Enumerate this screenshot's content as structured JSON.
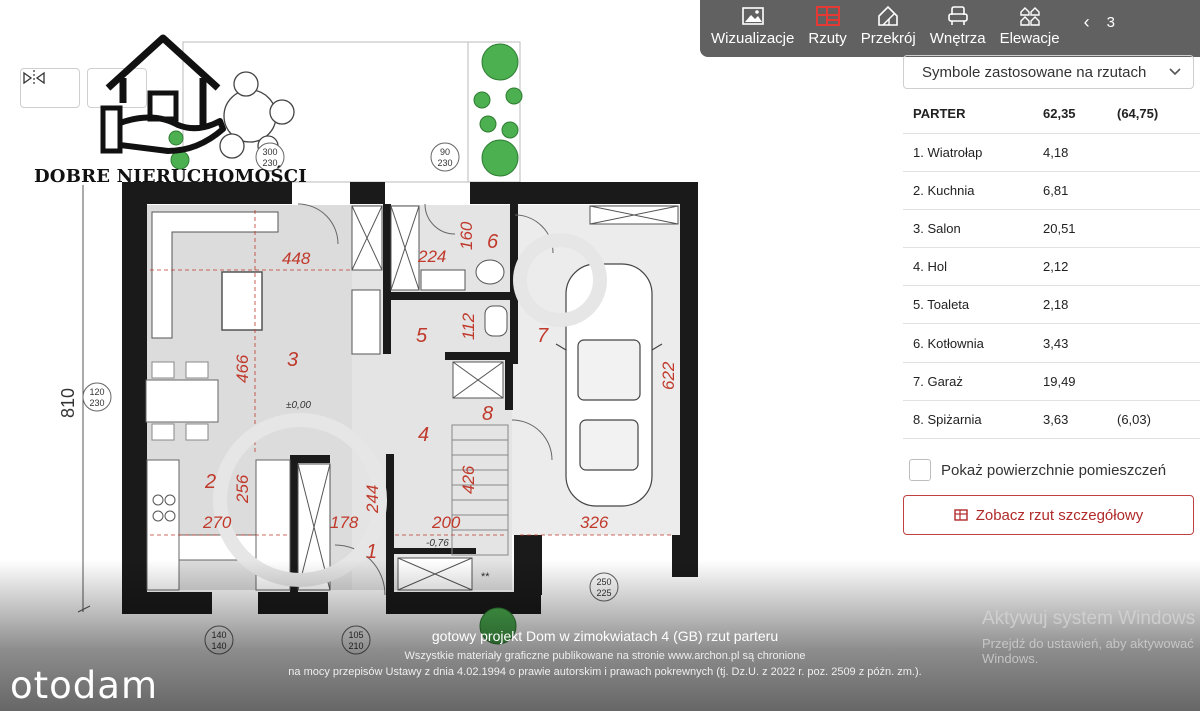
{
  "toolbar": {
    "tabs": [
      {
        "label": "Wizualizacje",
        "icon": "image-icon"
      },
      {
        "label": "Rzuty",
        "icon": "floorplan-icon",
        "active": true
      },
      {
        "label": "Przekrój",
        "icon": "house-section-icon"
      },
      {
        "label": "Wnętrza",
        "icon": "armchair-icon"
      },
      {
        "label": "Elewacje",
        "icon": "elevation-icon"
      }
    ],
    "prev_icon": "‹",
    "more_label": "3"
  },
  "logo": {
    "text": "DOBRE NIERUCHOMOŚCI"
  },
  "plan": {
    "room_numbers": [
      "1",
      "2",
      "3",
      "4",
      "5",
      "6",
      "7",
      "8"
    ],
    "dimensions": {
      "d448": "448",
      "d466": "466",
      "d256": "256",
      "d270": "270",
      "d178": "178",
      "d244": "244",
      "d224": "224",
      "d160": "160",
      "d112": "112",
      "d426": "426",
      "d200": "200",
      "d326": "326",
      "d622": "622",
      "d810": "810"
    },
    "levels": {
      "ground": "±0,00",
      "step": "-0,76"
    },
    "openings": [
      {
        "w": "300",
        "h": "230"
      },
      {
        "w": "90",
        "h": "230"
      },
      {
        "w": "120",
        "h": "230"
      },
      {
        "w": "250",
        "h": "225"
      },
      {
        "w": "140",
        "h": "140"
      },
      {
        "w": "105",
        "h": "210"
      }
    ],
    "stairs_mark": "**"
  },
  "panel": {
    "symbols_label": "Symbole zastosowane na rzutach",
    "level": {
      "name": "PARTER",
      "area": "62,35",
      "area_total": "(64,75)"
    },
    "rooms": [
      {
        "name": "1. Wiatrołap",
        "area": "4,18",
        "extra": ""
      },
      {
        "name": "2. Kuchnia",
        "area": "6,81",
        "extra": ""
      },
      {
        "name": "3. Salon",
        "area": "20,51",
        "extra": ""
      },
      {
        "name": "4. Hol",
        "area": "2,12",
        "extra": ""
      },
      {
        "name": "5. Toaleta",
        "area": "2,18",
        "extra": ""
      },
      {
        "name": "6. Kotłownia",
        "area": "3,43",
        "extra": ""
      },
      {
        "name": "7. Garaż",
        "area": "19,49",
        "extra": ""
      },
      {
        "name": "8. Spiżarnia",
        "area": "3,63",
        "extra": "(6,03)"
      }
    ],
    "show_areas_label": "Pokaż powierzchnie pomieszczeń",
    "detail_button_label": "Zobacz rzut szczegółowy"
  },
  "caption": {
    "title": "gotowy projekt Dom w zimokwiatach 4 (GB) rzut parteru",
    "line2": "Wszystkie materiały graficzne publikowane na stronie www.archon.pl są chronione",
    "line3": "na mocy przepisów Ustawy z dnia 4.02.1994 o prawie autorskim i prawach pokrewnych (tj. Dz.U. z 2022 r. poz. 2509 z późn. zm.)."
  },
  "brand": "otodam",
  "windows": {
    "line1": "Aktywuj system Windows",
    "line2": "Przejdź do ustawień, aby aktywować",
    "line3": "Windows."
  },
  "colors": {
    "toolbar_bg": "#616161",
    "accent": "#c04040",
    "plan_red": "#c0392b",
    "room_fill": "#dcdcdc"
  }
}
